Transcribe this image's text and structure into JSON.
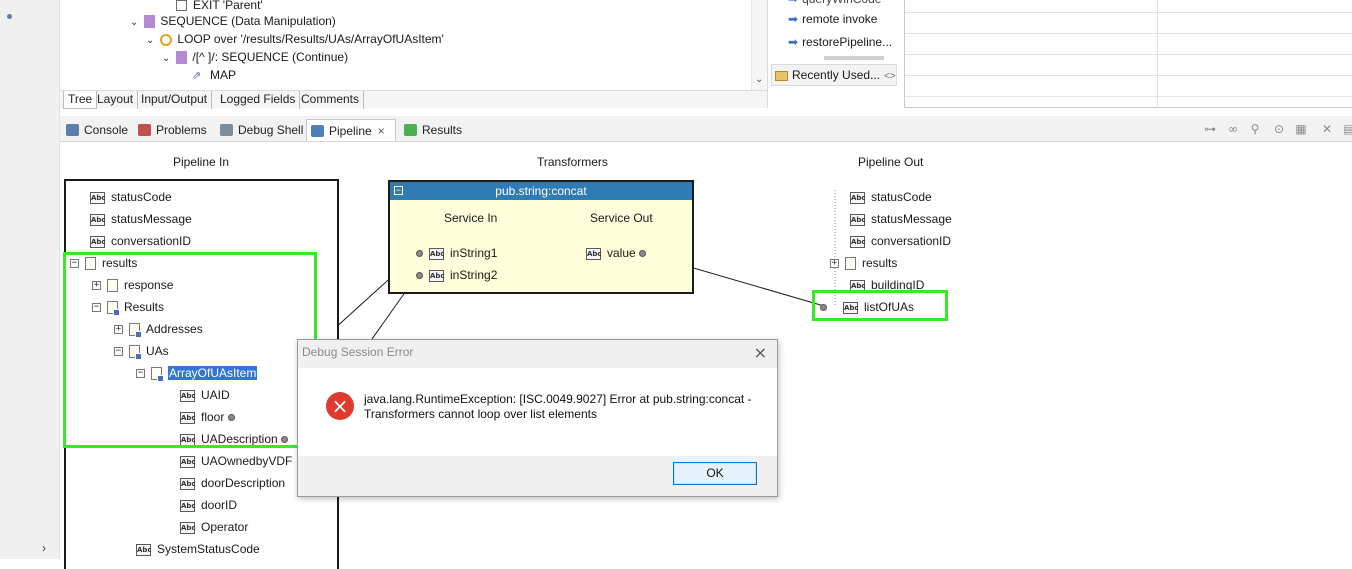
{
  "outline": {
    "rows": [
      {
        "label": "EXIT 'Parent'"
      },
      {
        "label": "SEQUENCE (Data Manipulation)"
      },
      {
        "label": "LOOP over '/results/Results/UAs/ArrayOfUAsItem'"
      },
      {
        "label": "/[^ ]/: SEQUENCE (Continue)"
      },
      {
        "label": "MAP"
      }
    ],
    "bottom_tabs": [
      "Tree",
      "Layout",
      "Input/Output",
      "Logged Fields",
      "Comments"
    ]
  },
  "palette": {
    "items": [
      "queryWinCode",
      "remote invoke",
      "restorePipeline..."
    ],
    "recent_label": "Recently Used...",
    "recent_suffix": "<>"
  },
  "views": {
    "tabs": [
      "Console",
      "Problems",
      "Debug Shell",
      "Pipeline",
      "Results"
    ],
    "active": "Pipeline",
    "close_glyph": "×"
  },
  "pipeline": {
    "in_title": "Pipeline In",
    "transformers_title": "Transformers",
    "out_title": "Pipeline Out",
    "in_nodes": [
      "statusCode",
      "statusMessage",
      "conversationID",
      "results",
      "response",
      "Results",
      "Addresses",
      "UAs",
      "ArrayOfUAsItem",
      "UAID",
      "floor",
      "UADescription",
      "UAOwnedbyVDF",
      "doorDescription",
      "doorID",
      "Operator",
      "SystemStatusCode"
    ],
    "out_nodes": [
      "statusCode",
      "statusMessage",
      "conversationID",
      "results",
      "buildingID",
      "listOfUAs"
    ],
    "transformer": {
      "name": "pub.string:concat",
      "service_in": "Service In",
      "service_out": "Service Out",
      "inputs": [
        "inString1",
        "inString2"
      ],
      "output": "value"
    },
    "abc_glyph": "Abc",
    "expand_plus": "+",
    "expand_minus": "−"
  },
  "dialog": {
    "title": "Debug Session Error",
    "message_line1": "java.lang.RuntimeException: [ISC.0049.9027] Error at pub.string:concat -",
    "message_line2": "Transformers cannot loop over list elements",
    "ok": "OK",
    "close_glyph": "×",
    "error_glyph": "×"
  },
  "colors": {
    "highlight": "#37e82b",
    "transformer_header": "#2f7bb4",
    "transformer_body": "#ffffdc",
    "error": "#e03a2f"
  }
}
